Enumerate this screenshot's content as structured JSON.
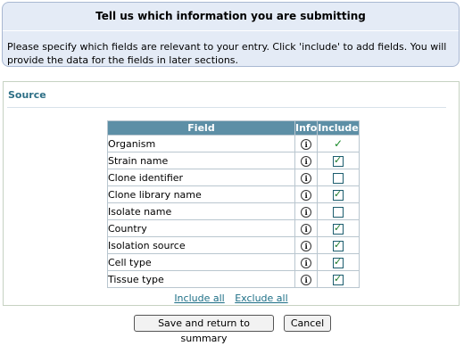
{
  "header": {
    "title": "Tell us which information you are submitting",
    "description": "Please specify which fields are relevant to your entry. Click 'include' to add fields. You will provide the data for the fields in later sections."
  },
  "source": {
    "title": "Source",
    "table": {
      "headers": [
        "Field",
        "Info",
        "Include"
      ],
      "rows": [
        {
          "field": "Organism",
          "included": "fixed"
        },
        {
          "field": "Strain name",
          "included": true
        },
        {
          "field": "Clone identifier",
          "included": false
        },
        {
          "field": "Clone library name",
          "included": true
        },
        {
          "field": "Isolate name",
          "included": false
        },
        {
          "field": "Country",
          "included": true
        },
        {
          "field": "Isolation source",
          "included": true
        },
        {
          "field": "Cell type",
          "included": true
        },
        {
          "field": "Tissue type",
          "included": true
        }
      ]
    },
    "links": {
      "include_all": "Include all",
      "exclude_all": "Exclude all"
    }
  },
  "buttons": {
    "save": "Save and return to summary",
    "cancel": "Cancel"
  },
  "icons": {
    "info": "info-icon",
    "check": "checkmark-icon"
  },
  "colors": {
    "header_bg": "#e4ebf6",
    "table_header_bg": "#5d8fa6",
    "accent_text": "#2d6f86",
    "check_color": "#1d7a2b"
  }
}
